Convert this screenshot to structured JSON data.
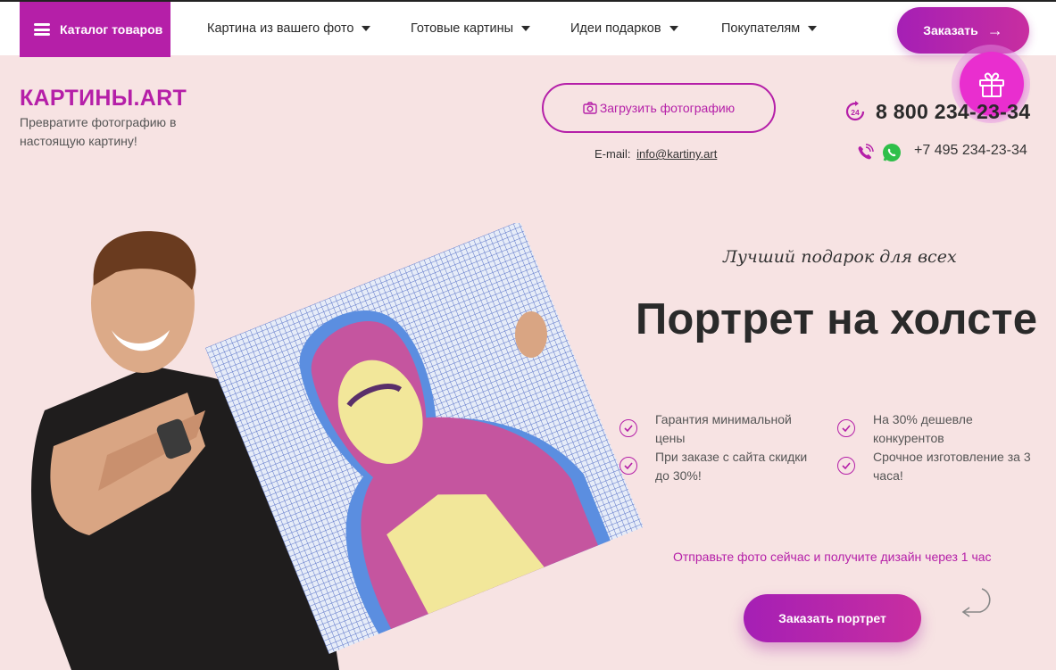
{
  "nav": {
    "catalog_label": "Каталог товаров",
    "items": [
      {
        "label": "Картина из вашего фото"
      },
      {
        "label": "Готовые картины"
      },
      {
        "label": "Идеи подарков"
      },
      {
        "label": "Покупателям"
      }
    ],
    "order_label": "Заказать"
  },
  "header": {
    "logo": "КАРТИНЫ.ART",
    "tagline": "Превратите фотографию в настоящую картину!",
    "upload_label": "Загрузить фотографию",
    "email_prefix": "E-mail:",
    "email": "info@kartiny.art",
    "phone_main": "8 800 234-23-34",
    "phone_second": "+7 495 234-23-34",
    "badge_24": "24"
  },
  "hero": {
    "subtitle": "Лучший подарок для всех",
    "title": "Портрет на холсте",
    "features": [
      {
        "text": "Гарантия минимальной цены"
      },
      {
        "text": "На 30% дешевле конкурентов"
      },
      {
        "text": "При заказе с сайта скидки до 30%!"
      },
      {
        "text": "Срочное изготовление за 3 часа!"
      }
    ],
    "promo": "Отправьте фото сейчас и получите дизайн через 1 час",
    "cta_label": "Заказать портрет"
  },
  "colors": {
    "accent": "#b51fa8",
    "background": "#f7e3e3",
    "gift": "#e92ecf",
    "whatsapp": "#2fbf4a"
  },
  "icons": [
    "menu-icon",
    "caret-down-icon",
    "arrow-right-icon",
    "gift-icon",
    "camera-icon",
    "clock-24-icon",
    "viber-icon",
    "whatsapp-icon",
    "check-icon",
    "curved-arrow-icon"
  ]
}
